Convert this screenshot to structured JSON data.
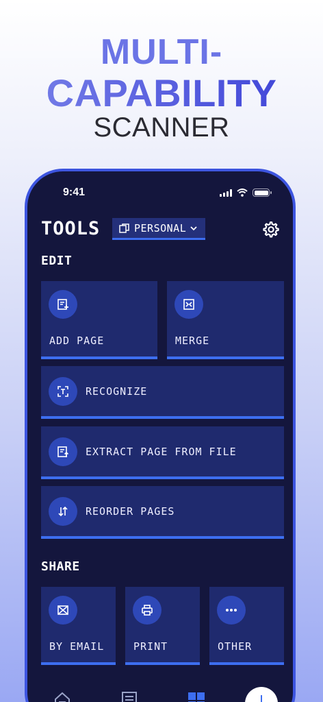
{
  "headline": {
    "line1": "MULTI-",
    "line2": "CAPABILITY",
    "line3": "SCANNER"
  },
  "status": {
    "time": "9:41"
  },
  "header": {
    "title": "TOOLS",
    "workspace": "PERSONAL"
  },
  "edit": {
    "title": "EDIT",
    "items": [
      {
        "label": "ADD PAGE",
        "icon": "add-page-icon"
      },
      {
        "label": "MERGE",
        "icon": "merge-icon"
      },
      {
        "label": "RECOGNIZE",
        "icon": "recognize-icon"
      },
      {
        "label": "EXTRACT PAGE FROM FILE",
        "icon": "extract-page-icon"
      },
      {
        "label": "REORDER PAGES",
        "icon": "reorder-icon"
      }
    ]
  },
  "share": {
    "title": "SHARE",
    "items": [
      {
        "label": "BY EMAIL",
        "icon": "email-icon"
      },
      {
        "label": "PRINT",
        "icon": "print-icon"
      },
      {
        "label": "OTHER",
        "icon": "more-icon"
      }
    ]
  },
  "colors": {
    "background": "#14163d",
    "card": "#1f2a6e",
    "accent": "#3d6ef0",
    "icon_circle": "#2e48b8"
  }
}
